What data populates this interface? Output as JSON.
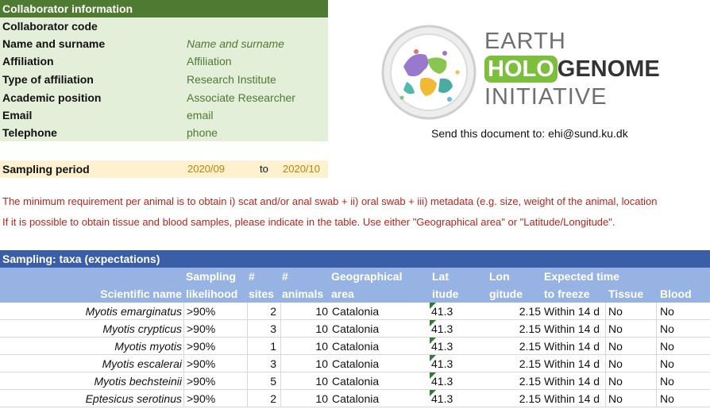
{
  "collaborator": {
    "header": "Collaborator information",
    "rows": [
      {
        "label": "Collaborator code",
        "value": ""
      },
      {
        "label": "Name and surname",
        "value": "Name and surname"
      },
      {
        "label": "Affiliation",
        "value": "Affiliation"
      },
      {
        "label": "Type of affiliation",
        "value": "Research Institute"
      },
      {
        "label": "Academic position",
        "value": "Associate Researcher"
      },
      {
        "label": "Email",
        "value": "email"
      },
      {
        "label": "Telephone",
        "value": "phone"
      }
    ]
  },
  "sampling_period": {
    "label": "Sampling period",
    "from": "2020/09",
    "to_word": "to",
    "to": "2020/10"
  },
  "logo": {
    "line1": "EARTH",
    "line2a": "HOLO",
    "line2b": "GENOME",
    "line3": "INITIATIVE"
  },
  "send_to": "Send this document to: ehi@sund.ku.dk",
  "notes": [
    "The minimum requirement per animal is to obtain i) scat and/or anal swab + ii) oral swab + iii) metadata (e.g. size, weight of the animal, location",
    "If it is possible to obtain tissue and blood samples, please indicate in the table. Use either \"Geographical area\" or \"Latitude/Longitude\"."
  ],
  "table": {
    "title": "Sampling: taxa (expectations)",
    "headers": {
      "scientific_name": "Scientific name",
      "sampling_1": "Sampling",
      "sampling_2": "likelihood",
      "sites_1": "#",
      "sites_2": "sites",
      "animals_1": "#",
      "animals_2": "animals",
      "geo_1": "Geographical",
      "geo_2": "area",
      "lat_1": "Lat",
      "lat_2": "itude",
      "lon_1": "Lon",
      "lon_2": "gitude",
      "time_1": "Expected time",
      "time_2": "to freeze",
      "tissue": "Tissue",
      "blood": "Blood"
    },
    "rows": [
      {
        "name": "Myotis emarginatus",
        "likelihood": ">90%",
        "sites": "2",
        "animals": "10",
        "area": "Catalonia",
        "lat": "41.3",
        "lon": "2.15",
        "freeze": "Within 14 d",
        "tissue": "No",
        "blood": "No"
      },
      {
        "name": "Myotis crypticus",
        "likelihood": ">90%",
        "sites": "3",
        "animals": "10",
        "area": "Catalonia",
        "lat": "41.3",
        "lon": "2.15",
        "freeze": "Within 14 d",
        "tissue": "No",
        "blood": "No"
      },
      {
        "name": "Myotis myotis",
        "likelihood": ">90%",
        "sites": "1",
        "animals": "10",
        "area": "Catalonia",
        "lat": "41.3",
        "lon": "2.15",
        "freeze": "Within 14 d",
        "tissue": "No",
        "blood": "No"
      },
      {
        "name": "Myotis escalerai",
        "likelihood": ">90%",
        "sites": "3",
        "animals": "10",
        "area": "Catalonia",
        "lat": "41.3",
        "lon": "2.15",
        "freeze": "Within 14 d",
        "tissue": "No",
        "blood": "No"
      },
      {
        "name": "Myotis bechsteinii",
        "likelihood": ">90%",
        "sites": "5",
        "animals": "10",
        "area": "Catalonia",
        "lat": "41.3",
        "lon": "2.15",
        "freeze": "Within 14 d",
        "tissue": "No",
        "blood": "No"
      },
      {
        "name": "Eptesicus serotinus",
        "likelihood": ">90%",
        "sites": "2",
        "animals": "10",
        "area": "Catalonia",
        "lat": "41.3",
        "lon": "2.15",
        "freeze": "Within 14 d",
        "tissue": "No",
        "blood": "No"
      }
    ]
  },
  "colors": {
    "collab_header": "#4e7a32",
    "collab_body": "#e3efd9",
    "period_bg": "#fdf1d0",
    "note_red": "#c0221b",
    "table_header": "#3a5ea8",
    "column_header": "#97b3e3",
    "holo_green": "#7cbf3c"
  }
}
